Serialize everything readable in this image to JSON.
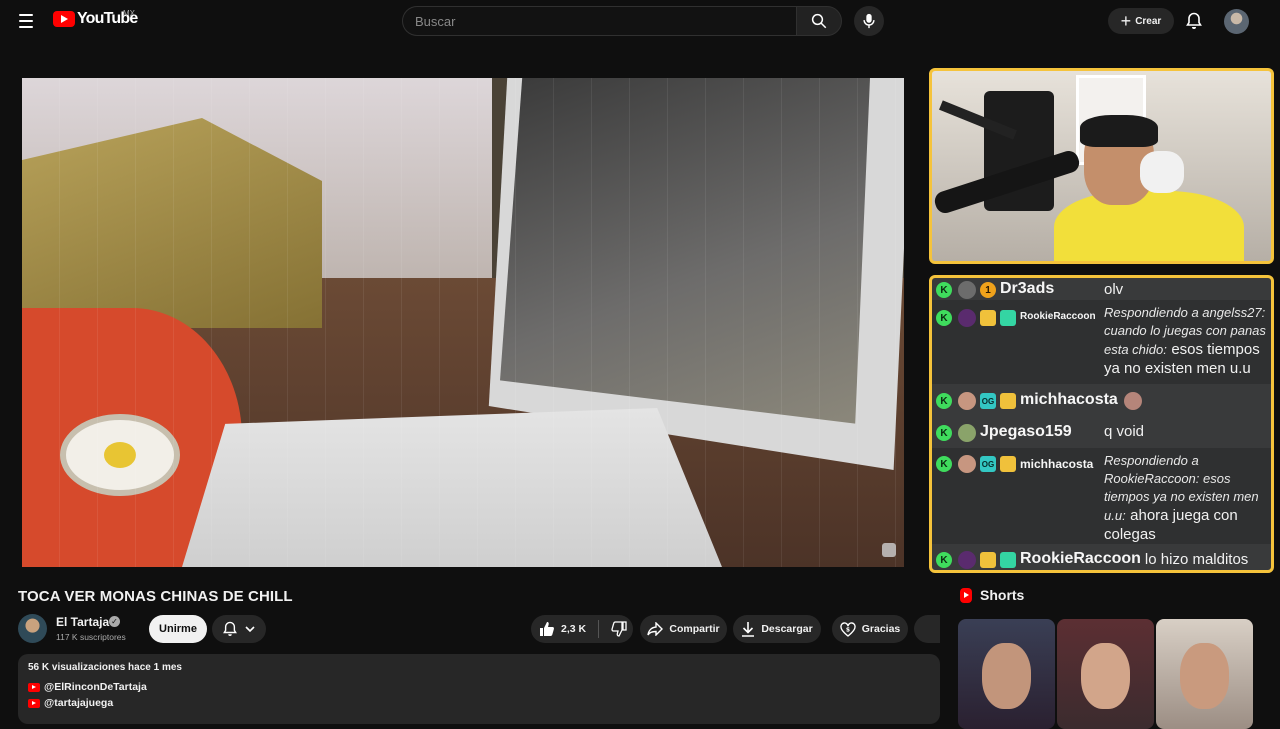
{
  "header": {
    "logo_text": "YouTube",
    "country_code": "MX",
    "search_placeholder": "Buscar",
    "create_label": "Crear"
  },
  "video": {
    "title": "TOCA VER MONAS CHINAS DE CHILL",
    "channel_name": "El Tartaja",
    "subscribers": "117 K suscriptores",
    "join_label": "Unirme",
    "likes": "2,3 K",
    "share_label": "Compartir",
    "download_label": "Descargar",
    "thanks_label": "Gracias"
  },
  "chat": {
    "messages": [
      {
        "badge_number": "1",
        "user": "Dr3ads",
        "text": "olv"
      },
      {
        "user": "RookieRaccoon",
        "reply": "Respondiendo a angelss27: cuando lo juegas con panas esta chido:",
        "text": "esos tiempos ya no existen men u.u"
      },
      {
        "user": "michhacosta",
        "text": ""
      },
      {
        "user": "Jpegaso159",
        "text": "q void"
      },
      {
        "user": "michhacosta",
        "reply": "Respondiendo a RookieRaccoon: esos tiempos ya no existen men u.u:",
        "text": "ahora juega con colegas"
      },
      {
        "user": "RookieRaccoon",
        "text": "lo hizo malditos"
      }
    ],
    "k_label": "K",
    "og_label": "OG"
  },
  "description": {
    "meta": "56 K visualizaciones  hace 1 mes",
    "links": [
      "@ElRinconDeTartaja",
      "@tartajajuega"
    ]
  },
  "shorts": {
    "header": "Shorts"
  },
  "colors": {
    "accent": "#f5c33b",
    "brand_red": "#ff0000",
    "kick_green": "#3fdc5d"
  }
}
